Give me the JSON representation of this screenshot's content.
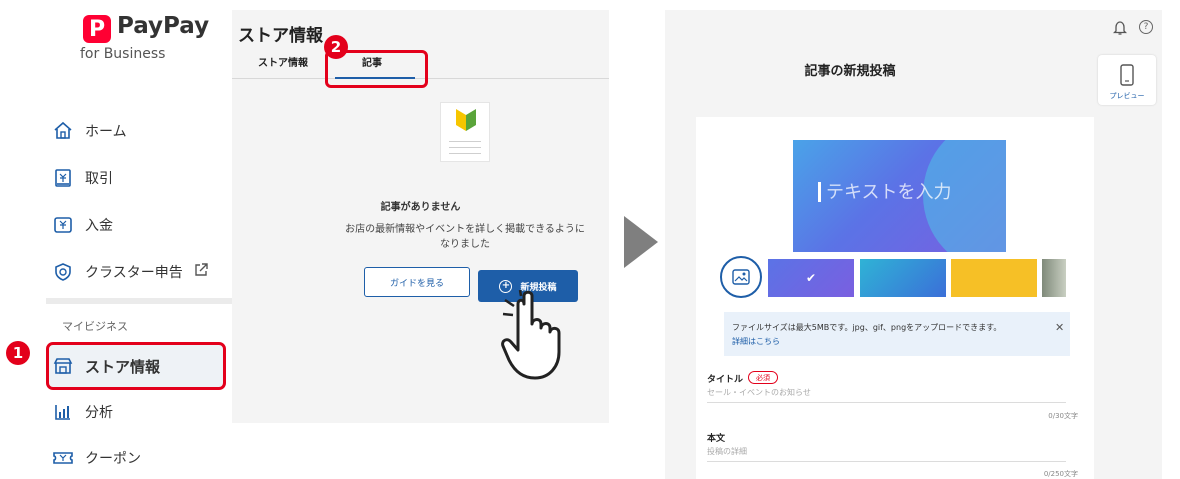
{
  "sidebar": {
    "logo": {
      "mark": "P",
      "name": "PayPay",
      "sub": "for Business"
    },
    "items": [
      {
        "label": "ホーム",
        "icon": "home-icon"
      },
      {
        "label": "取引",
        "icon": "receipt-icon"
      },
      {
        "label": "入金",
        "icon": "deposit-icon"
      },
      {
        "label": "クラスター申告",
        "icon": "shield-icon"
      },
      {
        "label": "ストア情報",
        "icon": "store-icon"
      },
      {
        "label": "分析",
        "icon": "chart-icon"
      },
      {
        "label": "クーポン",
        "icon": "coupon-icon"
      }
    ],
    "section_label": "マイビジネス"
  },
  "steps": {
    "one": "1",
    "two": "2"
  },
  "middle": {
    "title": "ストア情報",
    "tabs": [
      {
        "label": "ストア情報"
      },
      {
        "label": "記事"
      }
    ],
    "empty_title": "記事がありません",
    "empty_desc": "お店の最新情報やイベントを詳しく掲載できるように\nなりました",
    "guide_button": "ガイドを見る",
    "new_post_button": "新規投稿"
  },
  "right": {
    "title": "記事の新規投稿",
    "preview_label": "プレビュー",
    "hero_placeholder": "テキストを入力",
    "notice": {
      "text": "ファイルサイズは最大5MBです。jpg、gif、pngをアップロードできます。",
      "link": "詳細はこちら"
    },
    "title_field": {
      "label": "タイトル",
      "required": "必須",
      "placeholder": "セール・イベントのお知らせ",
      "counter": "0/30文字"
    },
    "body_field": {
      "label": "本文",
      "placeholder": "投稿の詳細",
      "counter": "0/250文字"
    }
  },
  "colors": {
    "brand_red": "#e3001b",
    "primary_blue": "#1e5ea8",
    "panel_bg": "#f4f4f4"
  }
}
